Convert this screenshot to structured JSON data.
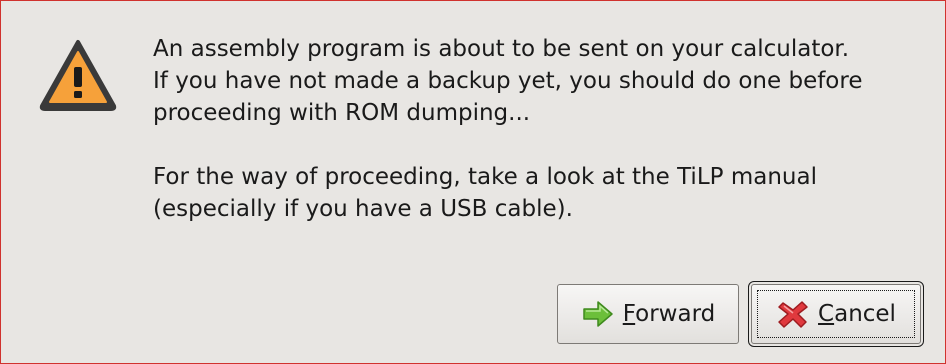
{
  "dialog": {
    "icon": "warning-icon",
    "message": {
      "line1": "An assembly program is about to be sent on your calculator.",
      "line2": "If you have not made a backup yet, you should do one before",
      "line3": "proceeding with ROM dumping...",
      "line4": "For the way of proceeding, take a look at the TiLP manual",
      "line5": "(especially if you have a USB cable)."
    },
    "buttons": {
      "forward": {
        "mnemonic": "F",
        "label_rest": "orward",
        "icon": "forward-arrow-icon"
      },
      "cancel": {
        "mnemonic": "C",
        "label_rest": "ancel",
        "icon": "cancel-x-icon"
      }
    }
  },
  "colors": {
    "background": "#e8e6e3",
    "border": "#d0322e",
    "warning_fill": "#f6a13a",
    "warning_stroke": "#3a3a3a",
    "forward_arrow": "#6cbf3a",
    "cancel_x": "#e0393e"
  }
}
